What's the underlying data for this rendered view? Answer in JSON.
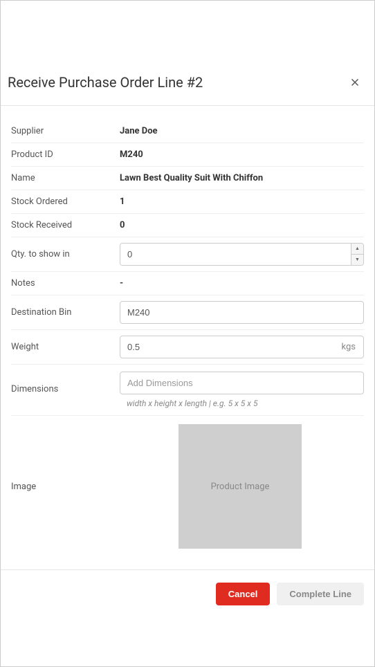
{
  "modal": {
    "title": "Receive Purchase Order Line #2"
  },
  "labels": {
    "supplier": "Supplier",
    "product_id": "Product ID",
    "name": "Name",
    "stock_ordered": "Stock Ordered",
    "stock_received": "Stock Received",
    "qty_show": "Qty. to show in",
    "notes": "Notes",
    "destination_bin": "Destination Bin",
    "weight": "Weight",
    "dimensions": "Dimensions",
    "image": "Image"
  },
  "values": {
    "supplier": "Jane Doe",
    "product_id": "M240",
    "name": "Lawn Best Quality Suit With Chiffon",
    "stock_ordered": "1",
    "stock_received": "0",
    "qty_show": "0",
    "notes": "-",
    "destination_bin": "M240",
    "weight": "0.5",
    "weight_unit": "kgs"
  },
  "placeholders": {
    "dimensions": "Add Dimensions"
  },
  "hints": {
    "dimensions": "width x height x length | e.g. 5 x 5 x 5"
  },
  "image_placeholder": "Product Image",
  "buttons": {
    "cancel": "Cancel",
    "complete": "Complete Line"
  }
}
